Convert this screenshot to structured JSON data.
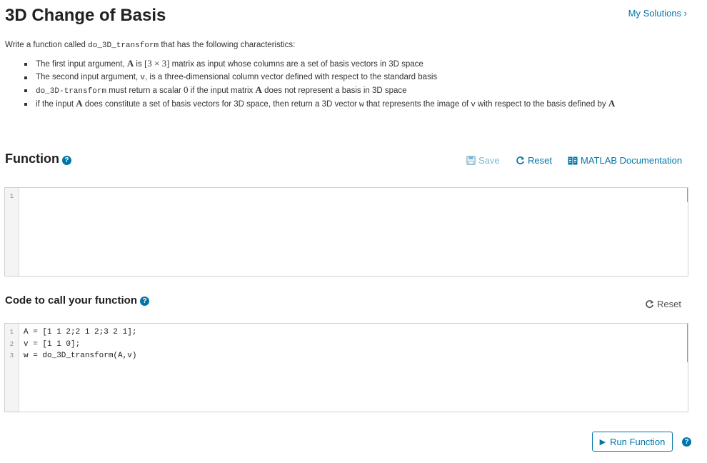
{
  "header": {
    "title": "3D Change of Basis",
    "my_solutions": "My Solutions ›"
  },
  "description": {
    "intro_prefix": "Write a function called ",
    "intro_code": "do_3D_transform",
    "intro_suffix": " that has the following characteristics:",
    "bullets": [
      {
        "p1": "The first input argument, ",
        "m1": "A",
        "p2": " is ",
        "m2": "[3 × 3]",
        "p3": " matrix as input whose columns are a set of basis vectors in 3D space"
      },
      {
        "p1": "The second input argument, ",
        "c1": "v",
        "p2": ", is a three-dimensional column vector defined with respect to the standard basis"
      },
      {
        "c1": "do_3D-transform",
        "p1": " must return a scalar ",
        "m1": "0",
        "p2": " if the input matrix ",
        "m2": "A",
        "p3": " does not represent a basis in 3D space"
      },
      {
        "p1": "if the input ",
        "m1": "A",
        "p2": " does constitute a set of basis vectors for 3D space, then return a 3D vector ",
        "c1": "w",
        "p3": " that represents the image of ",
        "c2": "v",
        "p4": " with respect to the basis defined by ",
        "m2": "A"
      }
    ]
  },
  "function_section": {
    "title": "Function",
    "save_label": "Save",
    "reset_label": "Reset",
    "docs_label": "MATLAB Documentation",
    "line_numbers": [
      "1"
    ],
    "code_lines": [
      ""
    ]
  },
  "call_section": {
    "title": "Code to call your function",
    "reset_label": "Reset",
    "line_numbers": [
      "1",
      "2",
      "3"
    ],
    "code_lines": [
      "A = [1 1 2;2 1 2;3 2 1];",
      "v = [1 1 0];",
      "w = do_3D_transform(A,v)"
    ]
  },
  "run": {
    "label": "Run Function"
  },
  "icons": {
    "help": "?",
    "play": "▶"
  },
  "colors": {
    "accent": "#0076a8",
    "accent_disabled": "#7fb6d2",
    "text": "#212121"
  }
}
